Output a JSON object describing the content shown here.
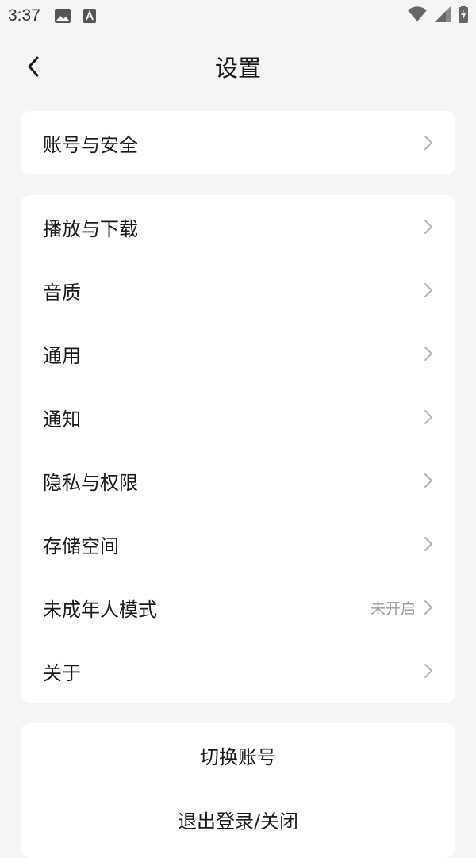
{
  "status_bar": {
    "time": "3:37",
    "icons_left": [
      "image-icon",
      "text-a-icon"
    ],
    "icons_right": [
      "wifi-icon",
      "signal-icon",
      "battery-charging-icon"
    ]
  },
  "header": {
    "title": "设置",
    "back_icon": "back-arrow-icon"
  },
  "groups": {
    "account": [
      {
        "label": "账号与安全"
      }
    ],
    "settings": [
      {
        "label": "播放与下载"
      },
      {
        "label": "音质"
      },
      {
        "label": "通用"
      },
      {
        "label": "通知"
      },
      {
        "label": "隐私与权限"
      },
      {
        "label": "存储空间"
      },
      {
        "label": "未成年人模式",
        "value": "未开启"
      },
      {
        "label": "关于"
      }
    ]
  },
  "actions": {
    "switch_account": "切换账号",
    "logout": "退出登录/关闭"
  },
  "colors": {
    "background": "#f4f5f7",
    "card": "#ffffff",
    "text": "#1a1a1a",
    "secondary_text": "#9a9a9a",
    "chevron": "#b3b3b3"
  }
}
